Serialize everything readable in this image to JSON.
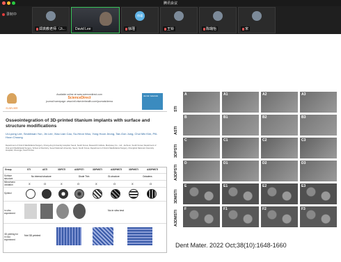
{
  "window": {
    "title": "腾讯会议"
  },
  "recording": {
    "label": "录制中"
  },
  "participants": [
    {
      "name": "郑龚教老师（Ji...",
      "muted": true,
      "type": "avatar"
    },
    {
      "name": "David Lee",
      "muted": false,
      "type": "camera",
      "active": true
    },
    {
      "name": "徐瑾",
      "muted": true,
      "type": "initials",
      "initials": "徐瑾"
    },
    {
      "name": "王铃",
      "muted": true,
      "type": "avatar"
    },
    {
      "name": "陈璐怡",
      "muted": true,
      "type": "avatar"
    },
    {
      "name": "宋",
      "muted": true,
      "type": "avatar"
    }
  ],
  "paper": {
    "elsevier": "ELSEVIER",
    "journal_line1": "Available online at www.sciencedirect.com",
    "journal_brand": "ScienceDirect",
    "journal_line2": "journal homepage: www.intl.elsevierhealth.com/journals/dema",
    "cover_text": "dental materials",
    "title": "Osseointegration of 3D-printed titanium implants with surface and structure modifications",
    "authors": "Ui-Lyong Lee, Seokhwan Yun, Jin Lee, Xiao Lian Cao, Su-Heon Woo, Yong Hoon Jeong, Tae-Gon Jung, Chul Min Kim, Pill-Hoon Choung",
    "affiliations": "Department of Oral & Maxillofacial Surgery, Chung-Ang University Hospital, Seoul, South Korea; Research Institute, Medyssey Co., Ltd., Jecheon, South Korea; Department of Oral and Maxillofacial Surgery, School of Dentistry, Seoul National University, Seoul, South Korea; Department of Oral & Maxillofacial Surgery, Chungbuk National University Hospital, Cheongju, South Korea"
  },
  "table": {
    "headers": [
      "Group",
      "STI",
      "ASTI",
      "3DPSTI",
      "A3DPSTI",
      "3DPMSTI",
      "A3DPMSTI",
      "3DPMSTI",
      "A3DPMSTI"
    ],
    "rows": [
      "Surface structure",
      "Micro/nano oxidation",
      "Symbol",
      "In vitro experiment",
      "3D printing for in vivo experiment"
    ],
    "subheaders": [
      "No internal structure",
      "Diode Thin",
      "Gi-structure",
      "Octadens"
    ],
    "marks": [
      "X",
      "O",
      "X",
      "O",
      "X",
      "O",
      "X",
      "O"
    ],
    "in_vitro_note": "No in vitro test",
    "not_printed": "Not 3D printed"
  },
  "figure": {
    "row_labels": [
      "STI",
      "ASTI",
      "3DPSTI",
      "A3DPSTI",
      "3DMSTI",
      "A3DMSTI"
    ],
    "col_tags": [
      [
        "A",
        "A1",
        "A2",
        "A3"
      ],
      [
        "B",
        "B1",
        "B2",
        "B3"
      ],
      [
        "C",
        "C1",
        "C2",
        "C3"
      ],
      [
        "D",
        "D1",
        "D2",
        "D3"
      ],
      [
        "E",
        "E1",
        "E2",
        "E3"
      ],
      [
        "F",
        "F1",
        "F2",
        "F3"
      ]
    ]
  },
  "citation": "Dent Mater. 2022 Oct;38(10):1648-1660",
  "colors": {
    "accent_green": "#39c35a",
    "mic_muted": "#e05555",
    "elsevier_orange": "#e9711c"
  }
}
